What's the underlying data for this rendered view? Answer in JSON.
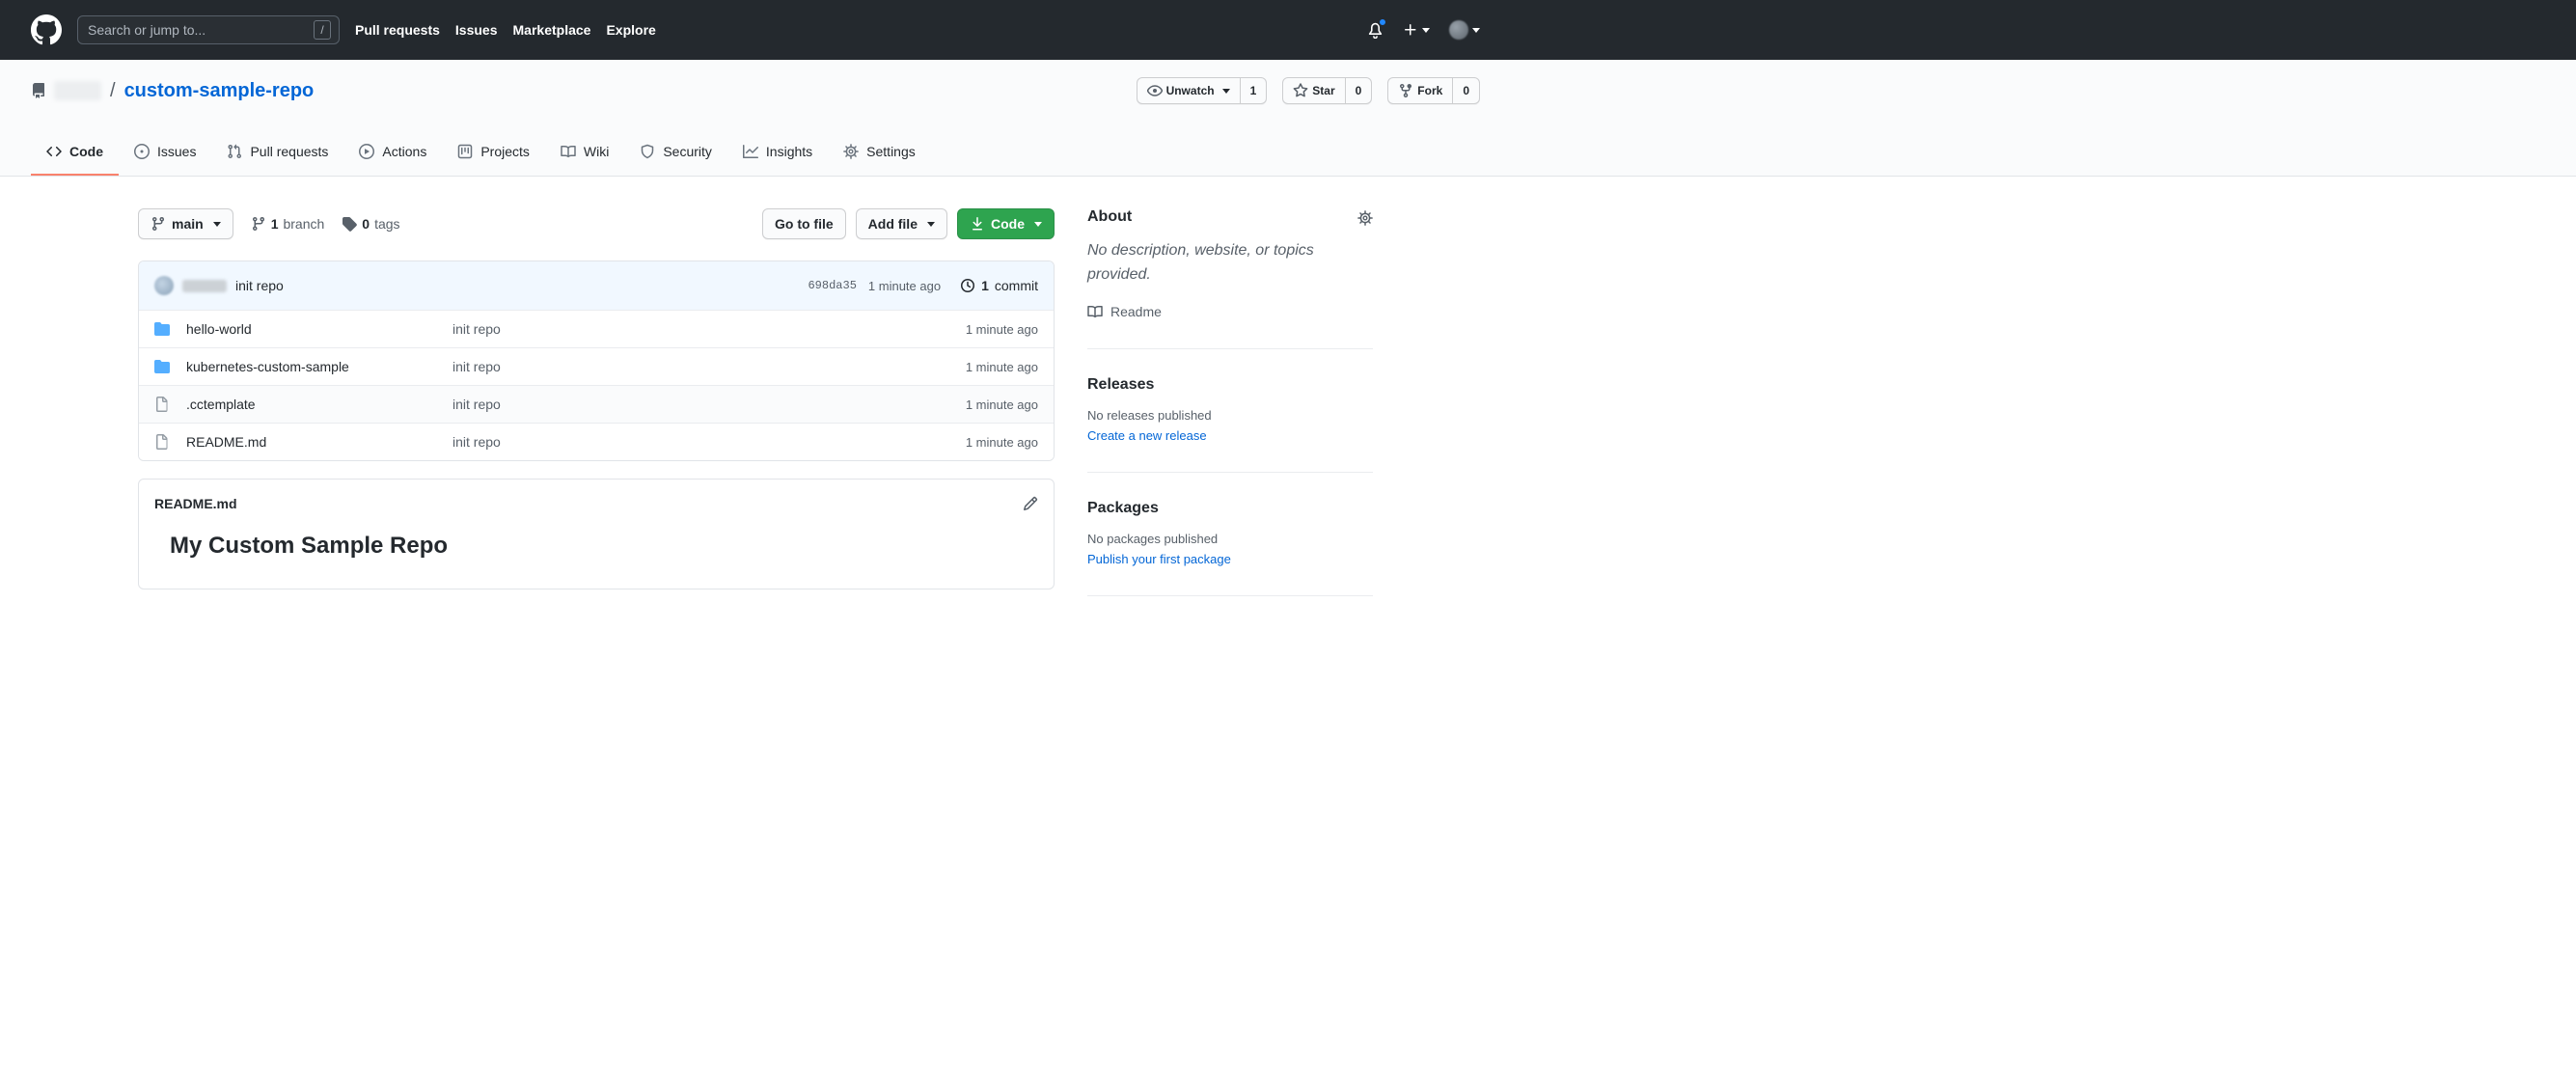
{
  "header": {
    "search_placeholder": "Search or jump to...",
    "search_shortcut": "/",
    "nav": [
      "Pull requests",
      "Issues",
      "Marketplace",
      "Explore"
    ]
  },
  "repo": {
    "name": "custom-sample-repo",
    "separator": "/",
    "actions": {
      "unwatch": {
        "label": "Unwatch",
        "count": "1"
      },
      "star": {
        "label": "Star",
        "count": "0"
      },
      "fork": {
        "label": "Fork",
        "count": "0"
      }
    },
    "tabs": [
      {
        "label": "Code"
      },
      {
        "label": "Issues"
      },
      {
        "label": "Pull requests"
      },
      {
        "label": "Actions"
      },
      {
        "label": "Projects"
      },
      {
        "label": "Wiki"
      },
      {
        "label": "Security"
      },
      {
        "label": "Insights"
      },
      {
        "label": "Settings"
      }
    ]
  },
  "toolbar": {
    "branch": "main",
    "branches": {
      "count": "1",
      "label": "branch"
    },
    "tags": {
      "count": "0",
      "label": "tags"
    },
    "goto_file": "Go to file",
    "add_file": "Add file",
    "code": "Code"
  },
  "commit_bar": {
    "message": "init repo",
    "sha": "698da35",
    "time": "1 minute ago",
    "count": "1",
    "count_label": "commit"
  },
  "files": [
    {
      "name": "hello-world",
      "type": "folder",
      "message": "init repo",
      "time": "1 minute ago"
    },
    {
      "name": "kubernetes-custom-sample",
      "type": "folder",
      "message": "init repo",
      "time": "1 minute ago"
    },
    {
      "name": ".cctemplate",
      "type": "file",
      "message": "init repo",
      "time": "1 minute ago"
    },
    {
      "name": "README.md",
      "type": "file",
      "message": "init repo",
      "time": "1 minute ago"
    }
  ],
  "readme": {
    "filename": "README.md",
    "title": "My Custom Sample Repo"
  },
  "sidebar": {
    "about": {
      "title": "About",
      "description": "No description, website, or topics provided.",
      "readme_link": "Readme"
    },
    "releases": {
      "title": "Releases",
      "empty": "No releases published",
      "link": "Create a new release"
    },
    "packages": {
      "title": "Packages",
      "empty": "No packages published",
      "link": "Publish your first package"
    }
  },
  "colors": {
    "header_bg": "#24292e",
    "link_blue": "#0366d6",
    "accent_green": "#2ea44f",
    "tab_underline": "#f9826c",
    "folder_icon": "#54aeff",
    "commit_bar_bg": "#f1f8ff",
    "notification_dot": "#2188ff"
  }
}
